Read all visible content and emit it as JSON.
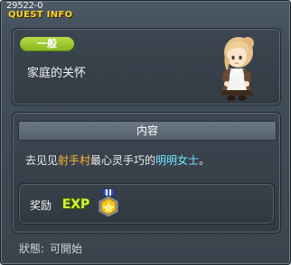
{
  "window": {
    "quest_id": "29522-0",
    "title": "QUEST INFO"
  },
  "quest": {
    "category": "一般",
    "name": "家庭的关怀"
  },
  "content": {
    "header": "内容",
    "description": {
      "part1": "去见见",
      "place": "射手村",
      "part2": "最心灵手巧的",
      "npc": "明明女士",
      "part3": "。"
    }
  },
  "reward": {
    "label": "奖励",
    "items": [
      {
        "icon": "exp-icon",
        "text": "EXP"
      },
      {
        "icon": "medal-icon"
      }
    ]
  },
  "status": {
    "label": "狀態:",
    "value": "可開始"
  },
  "colors": {
    "title": "#ffd428",
    "category": "#9ac82e",
    "highlight_place": "#ffb43c",
    "highlight_npc": "#6fe8ff"
  }
}
